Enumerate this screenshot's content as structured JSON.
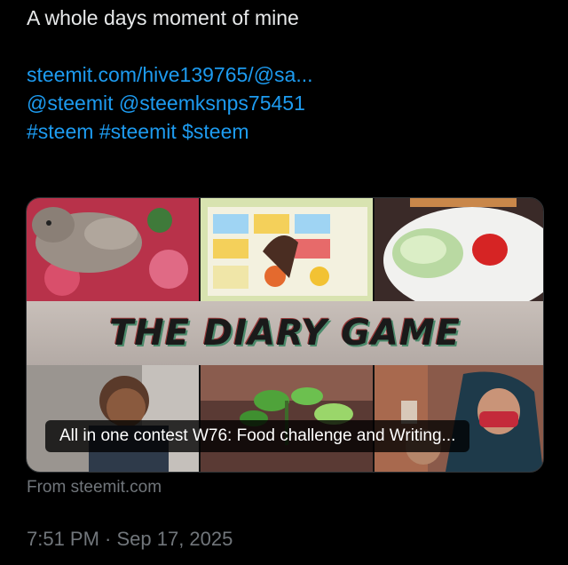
{
  "tweet": {
    "text": "A whole days moment of mine",
    "link": "steemit.com/hive139765/@sa...",
    "mentions": "@steemit @steemksnps75451",
    "hashtags": "#steem #steemit $steem"
  },
  "card": {
    "banner_title": "THE DIARY GAME",
    "caption": "All in one contest W76: Food challenge and Writing...",
    "source": "From steemit.com"
  },
  "meta": {
    "timestamp": "7:51 PM · Sep 17, 2025"
  },
  "colors": {
    "background": "#000000",
    "text": "#e7e9ea",
    "link": "#1d9bf0",
    "muted": "#71767b"
  }
}
